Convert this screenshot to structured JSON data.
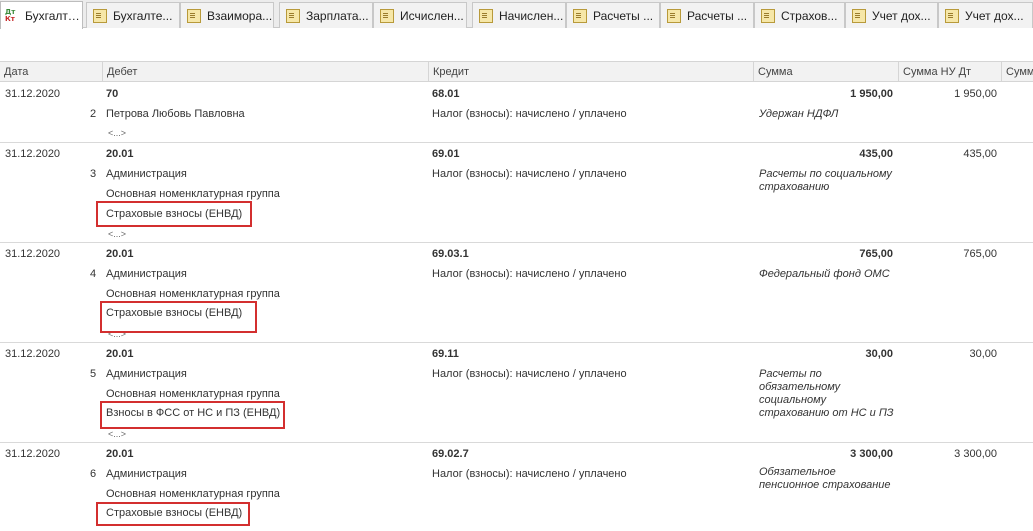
{
  "tabs": [
    {
      "label": "Бухгалте...",
      "icon": "dt-kt-icon",
      "active": true
    },
    {
      "label": "Бухгалте...",
      "icon": "document-icon"
    },
    {
      "label": "Взаимора...",
      "icon": "document-icon"
    },
    {
      "label": "Зарплата...",
      "icon": "document-icon"
    },
    {
      "label": "Исчислен...",
      "icon": "document-icon"
    },
    {
      "label": "Начислен...",
      "icon": "document-icon"
    },
    {
      "label": "Расчеты ...",
      "icon": "document-icon"
    },
    {
      "label": "Расчеты ...",
      "icon": "document-icon"
    },
    {
      "label": "Страхов...",
      "icon": "document-icon"
    },
    {
      "label": "Учет дох...",
      "icon": "document-icon"
    },
    {
      "label": "Учет дох...",
      "icon": "document-icon"
    }
  ],
  "columns": {
    "date": "Дата",
    "debit": "Дебет",
    "credit": "Кредит",
    "amount": "Сумма",
    "amount_nu_dt": "Сумма НУ Дт",
    "amount_more": "Сумм"
  },
  "more_marker": "<...>",
  "rows": [
    {
      "date": "31.12.2020",
      "n": "2",
      "debit_account": "70",
      "debit_sub1": "Петрова Любовь Павловна",
      "credit_account": "68.01",
      "credit_sub1": "Налог (взносы): начислено / уплачено",
      "amount": "1 950,00",
      "amount_nu": "1 950,00",
      "description": "Удержан НДФЛ"
    },
    {
      "date": "31.12.2020",
      "n": "3",
      "debit_account": "20.01",
      "debit_sub1": "Администрация",
      "debit_sub2": "Основная номенклатурная группа",
      "debit_sub3": "Страховые взносы (ЕНВД)",
      "credit_account": "69.01",
      "credit_sub1": "Налог (взносы): начислено / уплачено",
      "amount": "435,00",
      "amount_nu": "435,00",
      "description": "Расчеты по социальному страхованию"
    },
    {
      "date": "31.12.2020",
      "n": "4",
      "debit_account": "20.01",
      "debit_sub1": "Администрация",
      "debit_sub2": "Основная номенклатурная группа",
      "debit_sub3": "Страховые взносы (ЕНВД)",
      "credit_account": "69.03.1",
      "credit_sub1": "Налог (взносы): начислено / уплачено",
      "amount": "765,00",
      "amount_nu": "765,00",
      "description": "Федеральный фонд ОМС"
    },
    {
      "date": "31.12.2020",
      "n": "5",
      "debit_account": "20.01",
      "debit_sub1": "Администрация",
      "debit_sub2": "Основная номенклатурная группа",
      "debit_sub3": "Взносы в ФСС от НС и ПЗ (ЕНВД)",
      "credit_account": "69.11",
      "credit_sub1": "Налог (взносы): начислено / уплачено",
      "amount": "30,00",
      "amount_nu": "30,00",
      "description": "Расчеты по обязательному социальному страхованию от НС и ПЗ"
    },
    {
      "date": "31.12.2020",
      "n": "6",
      "debit_account": "20.01",
      "debit_sub1": "Администрация",
      "debit_sub2": "Основная номенклатурная группа",
      "debit_sub3": "Страховые взносы (ЕНВД)",
      "credit_account": "69.02.7",
      "credit_sub1": "Налог (взносы): начислено / уплачено",
      "amount": "3 300,00",
      "amount_nu": "3 300,00",
      "description": "Обязательное пенсионное страхование"
    }
  ],
  "colors": {
    "highlight": "#d32f2f",
    "header_bg": "#f2f2f2"
  }
}
